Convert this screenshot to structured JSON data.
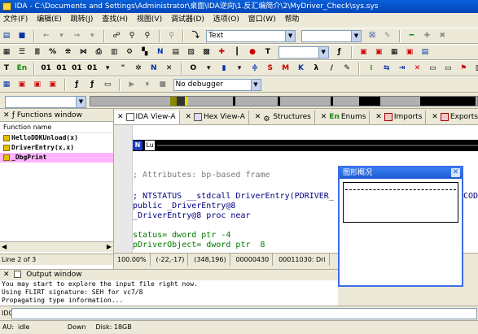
{
  "window": {
    "title": "IDA - C:\\Documents and Settings\\Administrator\\桌面\\IDA逆向\\1.反汇编简介\\2\\MyDriver_Check\\sys.sys"
  },
  "menu": [
    "文件(F)",
    "编辑(E)",
    "跳转(J)",
    "查找(H)",
    "视图(V)",
    "调试器(D)",
    "选项(O)",
    "窗口(W)",
    "帮助"
  ],
  "toolbar": {
    "text_combo_value": "Text",
    "debugger_combo_value": "No debugger"
  },
  "functions_window": {
    "title": "Functions window",
    "column": "Function name",
    "items": [
      "HelloDDKUnload(x)",
      "DriverEntry(x,x)",
      "_DbgPrint"
    ],
    "selected_index": 2,
    "status": "Line 2 of 3"
  },
  "tabs": [
    {
      "label": "IDA View-A",
      "active": true
    },
    {
      "label": "Hex View-A",
      "active": false
    },
    {
      "label": "Structures",
      "active": false
    },
    {
      "label": "Enums",
      "active": false
    },
    {
      "label": "Imports",
      "active": false
    },
    {
      "label": "Exports",
      "active": false
    }
  ],
  "code": {
    "lines": [
      "; Attributes: bp-based frame",
      "; NTSTATUS __stdcall DriverEntry(PDRIVER_",
      "public _DriverEntry@8",
      "_DriverEntry@8 proc near",
      "status= dword ptr -4",
      "pDriverObject= dword ptr  8"
    ],
    "overflow_text": "COD"
  },
  "status_mid": [
    "100.00%",
    "(-22,-17)",
    "(348,196)",
    "00000430",
    "00011030: Dri"
  ],
  "graph_overview": {
    "title": "图形概况"
  },
  "output_window": {
    "title": "Output window",
    "lines": [
      "You may start to explore the input file right now.",
      "Using FLIRT signature: SEH for vc7/8",
      "Propagating type information..."
    ]
  },
  "idc_label": "IDC",
  "statusbar": {
    "au": "AU:",
    "state": "idle",
    "direction": "Down",
    "disk": "Disk: 18GB"
  }
}
